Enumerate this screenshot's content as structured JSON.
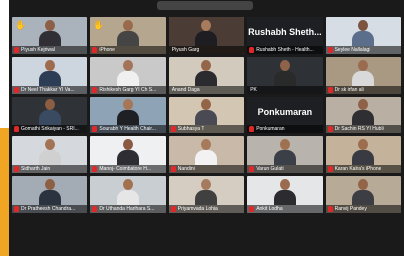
{
  "window": {
    "accent_color": "#d6e83b",
    "side_strip_color": "#f0a623"
  },
  "participants": [
    {
      "name": "Piyush Kejriwal",
      "raised_hand": true,
      "muted": true,
      "display": "video",
      "bg": "#aab3bb",
      "skin": "#8c5f47",
      "shirt": "#2f2f35"
    },
    {
      "name": "iPhone",
      "raised_hand": true,
      "muted": true,
      "display": "video",
      "bg": "#b4a68f",
      "skin": "#9a6a4c",
      "shirt": "#454545"
    },
    {
      "name": "Piyush Garg",
      "raised_hand": false,
      "muted": false,
      "display": "video",
      "active": true,
      "bg": "#4b3d35",
      "skin": "#a87b5c",
      "shirt": "#1e1e22"
    },
    {
      "name": "Rushabh Sheth - Health...",
      "big_name": "Rushabh Sheth...",
      "raised_hand": false,
      "muted": true,
      "display": "name"
    },
    {
      "name": "Seylee Nallalagi",
      "raised_hand": false,
      "muted": true,
      "display": "video",
      "bg": "#d7dde4",
      "skin": "#7c5440",
      "shirt": "#5b6e8c"
    },
    {
      "name": "Dr Neel Thakkar YI Va...",
      "raised_hand": false,
      "muted": true,
      "display": "video",
      "bg": "#cdd5de",
      "skin": "#9d6c4f",
      "shirt": "#2d3d55"
    },
    {
      "name": "Rishikesh Garg YI Ch S...",
      "raised_hand": false,
      "muted": true,
      "display": "video",
      "bg": "#c9c9c9",
      "skin": "#a3735a",
      "shirt": "#f0f0f0"
    },
    {
      "name": "Anand Daga",
      "raised_hand": false,
      "muted": false,
      "display": "video",
      "bg": "#d2cabc",
      "skin": "#946548",
      "shirt": "#2b2b2f"
    },
    {
      "name": "PK",
      "raised_hand": false,
      "muted": false,
      "display": "video",
      "bg": "#2e3135",
      "skin": "#8f634a",
      "shirt": "#2a2a2a"
    },
    {
      "name": "Dr sk irfan ali",
      "raised_hand": false,
      "muted": true,
      "display": "video",
      "bg": "#a99983",
      "skin": "#9b6b4f",
      "shirt": "#d9d9d9"
    },
    {
      "name": "Gomathi Srikaiyan - SRI...",
      "raised_hand": false,
      "muted": true,
      "display": "video",
      "bg": "#2f3236",
      "skin": "#8b5d43",
      "shirt": "#3a4a60"
    },
    {
      "name": "Sourabh Y Health Chair...",
      "raised_hand": false,
      "muted": true,
      "display": "video",
      "bg": "#8ea3b6",
      "skin": "#a67656",
      "shirt": "#1f2024"
    },
    {
      "name": "Subhasya T",
      "raised_hand": false,
      "muted": true,
      "display": "video",
      "bg": "#d3c7b4",
      "skin": "#936446",
      "shirt": "#4a4a55"
    },
    {
      "name": "Ponkumaran",
      "big_name": "Ponkumaran",
      "raised_hand": false,
      "muted": true,
      "display": "name"
    },
    {
      "name": "Dr Sachin RS YI Hubli",
      "raised_hand": false,
      "muted": true,
      "display": "video",
      "bg": "#b9b0a3",
      "skin": "#8f6148",
      "shirt": "#2f2f33"
    },
    {
      "name": "Sidharth Jain",
      "raised_hand": false,
      "muted": true,
      "display": "video",
      "bg": "#d5d9dd",
      "skin": "#a27455",
      "shirt": "#d0d0d0"
    },
    {
      "name": "Manoj- Coimbatore H...",
      "raised_hand": false,
      "muted": true,
      "display": "video",
      "bg": "#eef0f2",
      "skin": "#8a5b42",
      "shirt": "#2d2d33"
    },
    {
      "name": "Nandini",
      "raised_hand": false,
      "muted": true,
      "display": "video",
      "bg": "#c8b9a8",
      "skin": "#a77a5c",
      "shirt": "#f2f2f2"
    },
    {
      "name": "Varun Gulati",
      "raised_hand": false,
      "muted": true,
      "display": "video",
      "bg": "#b8b3ad",
      "skin": "#a07151",
      "shirt": "#3b3f48"
    },
    {
      "name": "Karan Kalra's iPhone",
      "raised_hand": false,
      "muted": true,
      "display": "video",
      "bg": "#c4b39a",
      "skin": "#9c6d4f",
      "shirt": "#3a3a42"
    },
    {
      "name": "Dr Pratheesh Chandra...",
      "raised_hand": false,
      "muted": true,
      "display": "video",
      "bg": "#a3acb4",
      "skin": "#8d5f45",
      "shirt": "#2c3340"
    },
    {
      "name": "Dr Uthanda Harihara S...",
      "raised_hand": false,
      "muted": true,
      "display": "video",
      "bg": "#c9ced3",
      "skin": "#a27250",
      "shirt": "#e6e6e6"
    },
    {
      "name": "Priyamvada Lohia",
      "raised_hand": false,
      "muted": true,
      "display": "video",
      "bg": "#d6cdc2",
      "skin": "#a67a5e",
      "shirt": "#404040"
    },
    {
      "name": "Ankit Lodha",
      "raised_hand": false,
      "muted": true,
      "display": "video",
      "bg": "#e4e6e8",
      "skin": "#9a6b4e",
      "shirt": "#2b2b30"
    },
    {
      "name": "Ranvij Pandey",
      "raised_hand": false,
      "muted": true,
      "display": "video",
      "bg": "#b7aa97",
      "skin": "#936548",
      "shirt": "#3d3d44"
    }
  ]
}
